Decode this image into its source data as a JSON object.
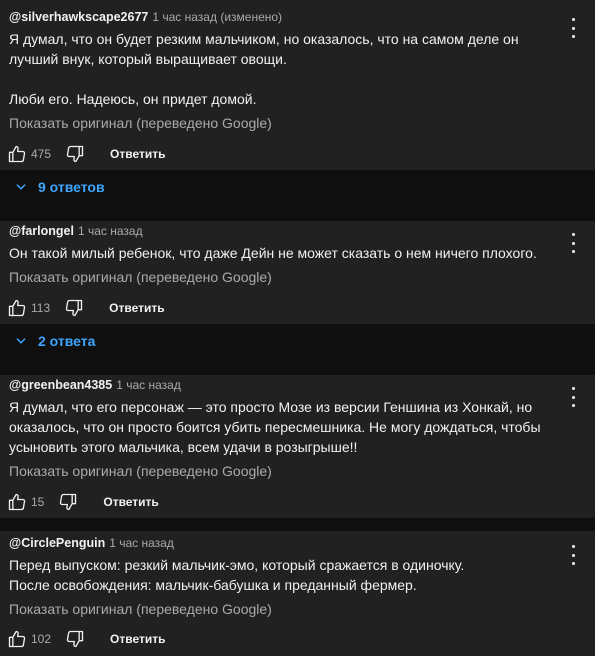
{
  "comments": [
    {
      "author": "@silverhawkscape2677",
      "time": "1 час назад (изменено)",
      "lines": [
        "Я думал, что он будет резким мальчиком, но оказалось, что на самом деле он лучший внук, который выращивает овощи.",
        "",
        "Люби его. Надеюсь, он придет домой."
      ],
      "original_link": "Показать оригинал (переведено Google)",
      "likes": "475",
      "reply_label": "Ответить",
      "replies_label": "9 ответов"
    },
    {
      "author": "@farlongel",
      "time": "1 час назад",
      "lines": [
        "Он такой милый ребенок, что даже Дейн не может сказать о нем ничего плохого."
      ],
      "original_link": "Показать оригинал (переведено Google)",
      "likes": "113",
      "reply_label": "Ответить",
      "replies_label": "2 ответа"
    },
    {
      "author": "@greenbean4385",
      "time": "1 час назад",
      "lines": [
        "Я думал, что его персонаж — это просто Мозе из версии Геншина из Хонкай, но оказалось, что он просто боится убить пересмешника. Не могу дождаться, чтобы усыновить этого мальчика, всем удачи в розыгрыше!!"
      ],
      "original_link": "Показать оригинал (переведено Google)",
      "likes": "15",
      "reply_label": "Ответить"
    },
    {
      "author": "@CirclePenguin",
      "time": "1 час назад",
      "lines": [
        "Перед выпуском: резкий мальчик-эмо, который сражается в одиночку.",
        "После освобождения: мальчик-бабушка и преданный фермер."
      ],
      "original_link": "Показать оригинал (переведено Google)",
      "likes": "102",
      "reply_label": "Ответить"
    }
  ],
  "colors": {
    "background": "#0f0f0f",
    "card": "#212121",
    "text": "#f1f1f1",
    "secondary": "#aaaaaa",
    "link_blue": "#3ea6ff"
  },
  "icons": [
    "more-vert-icon",
    "thumb-up-icon",
    "thumb-down-icon",
    "chevron-down-icon"
  ]
}
